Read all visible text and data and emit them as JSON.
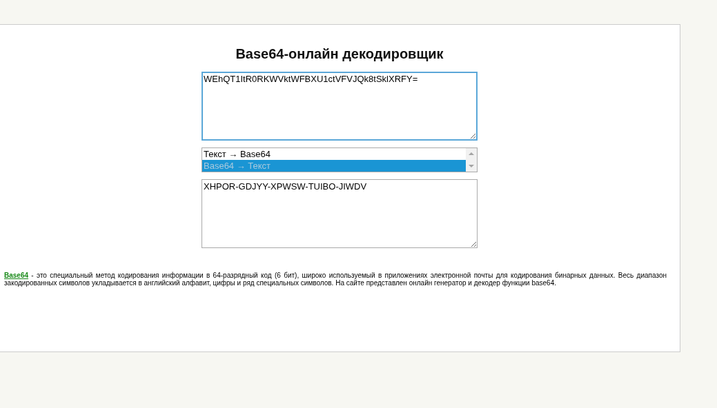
{
  "title": "Base64-онлайн декодировщик",
  "input": {
    "value": "WEhQT1ItR0RKWVktWFBXU1ctVFVJQk8tSklXRFY="
  },
  "modes": [
    {
      "label": "Текст → Base64",
      "selected": false
    },
    {
      "label": "Base64 → Текст",
      "selected": true
    }
  ],
  "output": {
    "value": "XHPOR-GDJYY-XPWSW-TUIBO-JIWDV"
  },
  "description": {
    "link": "Base64",
    "text": " - это специальный метод кодирования информации в 64-разрядный код (6 бит), широко используемый в приложениях электронной почты для кодирования бинарных данных. Весь диапазон закодированных символов укладывается в английский алфавит, цифры и ряд специальных символов. На сайте представлен онлайн генератор и декодер функции base64."
  }
}
